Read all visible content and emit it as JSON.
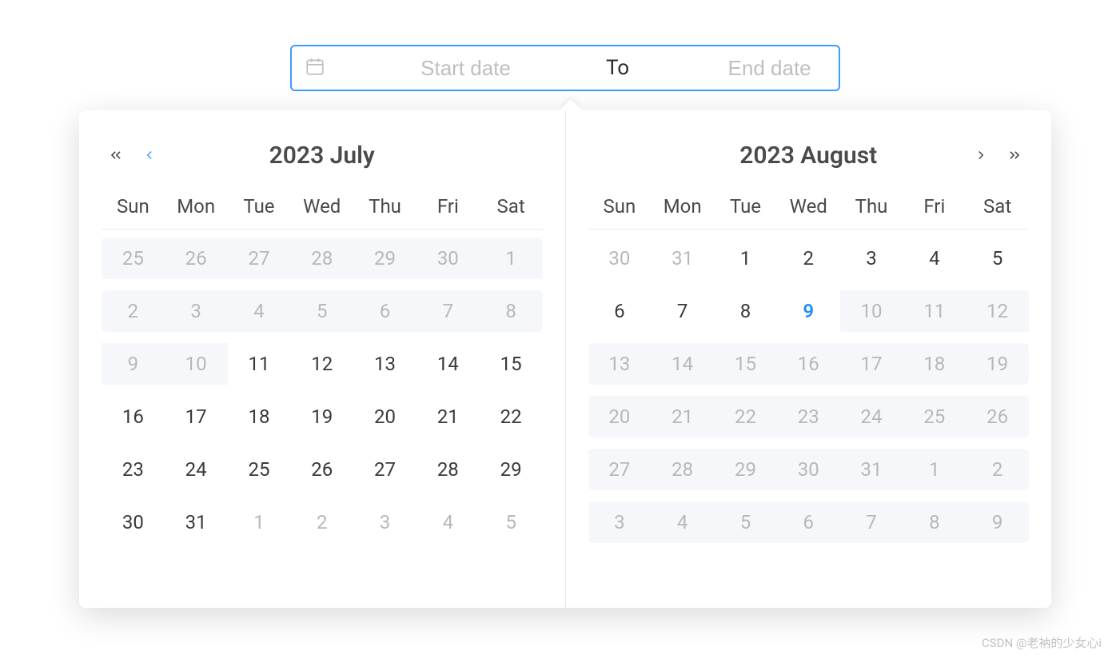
{
  "input": {
    "start_placeholder": "Start date",
    "end_placeholder": "End date",
    "separator": "To"
  },
  "dow": [
    "Sun",
    "Mon",
    "Tue",
    "Wed",
    "Thu",
    "Fri",
    "Sat"
  ],
  "left": {
    "title": "2023 July",
    "weeks": [
      {
        "shaded": true,
        "cells": [
          {
            "d": "25",
            "other": true
          },
          {
            "d": "26",
            "other": true
          },
          {
            "d": "27",
            "other": true
          },
          {
            "d": "28",
            "other": true
          },
          {
            "d": "29",
            "other": true
          },
          {
            "d": "30",
            "other": true
          },
          {
            "d": "1",
            "other": true
          }
        ]
      },
      {
        "shaded": true,
        "cells": [
          {
            "d": "2",
            "other": true
          },
          {
            "d": "3",
            "other": true
          },
          {
            "d": "4",
            "other": true
          },
          {
            "d": "5",
            "other": true
          },
          {
            "d": "6",
            "other": true
          },
          {
            "d": "7",
            "other": true
          },
          {
            "d": "8",
            "other": true
          }
        ]
      },
      {
        "shaded": false,
        "cells": [
          {
            "d": "9",
            "other": true,
            "shaded": true
          },
          {
            "d": "10",
            "other": true,
            "shaded": true
          },
          {
            "d": "11"
          },
          {
            "d": "12"
          },
          {
            "d": "13"
          },
          {
            "d": "14"
          },
          {
            "d": "15"
          }
        ]
      },
      {
        "shaded": false,
        "cells": [
          {
            "d": "16"
          },
          {
            "d": "17"
          },
          {
            "d": "18"
          },
          {
            "d": "19"
          },
          {
            "d": "20"
          },
          {
            "d": "21"
          },
          {
            "d": "22"
          }
        ]
      },
      {
        "shaded": false,
        "cells": [
          {
            "d": "23"
          },
          {
            "d": "24"
          },
          {
            "d": "25"
          },
          {
            "d": "26"
          },
          {
            "d": "27"
          },
          {
            "d": "28"
          },
          {
            "d": "29"
          }
        ]
      },
      {
        "shaded": false,
        "cells": [
          {
            "d": "30"
          },
          {
            "d": "31"
          },
          {
            "d": "1",
            "other": true
          },
          {
            "d": "2",
            "other": true
          },
          {
            "d": "3",
            "other": true
          },
          {
            "d": "4",
            "other": true
          },
          {
            "d": "5",
            "other": true
          }
        ]
      }
    ]
  },
  "right": {
    "title": "2023 August",
    "weeks": [
      {
        "shaded": false,
        "cells": [
          {
            "d": "30",
            "other": true
          },
          {
            "d": "31",
            "other": true
          },
          {
            "d": "1"
          },
          {
            "d": "2"
          },
          {
            "d": "3"
          },
          {
            "d": "4"
          },
          {
            "d": "5"
          }
        ]
      },
      {
        "shaded": false,
        "cells": [
          {
            "d": "6"
          },
          {
            "d": "7"
          },
          {
            "d": "8"
          },
          {
            "d": "9",
            "today": true
          },
          {
            "d": "10",
            "other": true,
            "shaded": true
          },
          {
            "d": "11",
            "other": true,
            "shaded": true
          },
          {
            "d": "12",
            "other": true,
            "shaded": true
          }
        ]
      },
      {
        "shaded": true,
        "cells": [
          {
            "d": "13",
            "other": true
          },
          {
            "d": "14",
            "other": true
          },
          {
            "d": "15",
            "other": true
          },
          {
            "d": "16",
            "other": true
          },
          {
            "d": "17",
            "other": true
          },
          {
            "d": "18",
            "other": true
          },
          {
            "d": "19",
            "other": true
          }
        ]
      },
      {
        "shaded": true,
        "cells": [
          {
            "d": "20",
            "other": true
          },
          {
            "d": "21",
            "other": true
          },
          {
            "d": "22",
            "other": true
          },
          {
            "d": "23",
            "other": true
          },
          {
            "d": "24",
            "other": true
          },
          {
            "d": "25",
            "other": true
          },
          {
            "d": "26",
            "other": true
          }
        ]
      },
      {
        "shaded": true,
        "cells": [
          {
            "d": "27",
            "other": true
          },
          {
            "d": "28",
            "other": true
          },
          {
            "d": "29",
            "other": true
          },
          {
            "d": "30",
            "other": true
          },
          {
            "d": "31",
            "other": true
          },
          {
            "d": "1",
            "other": true
          },
          {
            "d": "2",
            "other": true
          }
        ]
      },
      {
        "shaded": true,
        "cells": [
          {
            "d": "3",
            "other": true
          },
          {
            "d": "4",
            "other": true
          },
          {
            "d": "5",
            "other": true
          },
          {
            "d": "6",
            "other": true
          },
          {
            "d": "7",
            "other": true
          },
          {
            "d": "8",
            "other": true
          },
          {
            "d": "9",
            "other": true
          }
        ]
      }
    ]
  },
  "watermark": "CSDN @老衲的少女心i"
}
